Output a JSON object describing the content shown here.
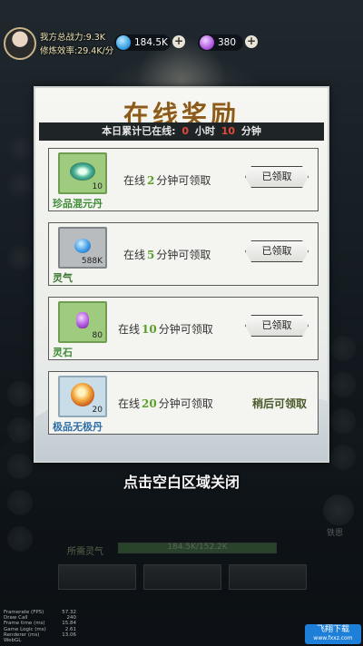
{
  "player": {
    "power_label": "我方总战力:9.3K",
    "efficiency_label": "修炼效率:29.4K/分"
  },
  "resources": [
    {
      "name": "spirit-stone",
      "value": "184.5K",
      "color": "#3aa3e6"
    },
    {
      "name": "jade",
      "value": "380",
      "color": "#b25be0"
    }
  ],
  "modal": {
    "title": "在线奖励",
    "online_prefix": "本日累计已在线:",
    "hours": "0",
    "hour_unit": "小时",
    "minutes": "10",
    "minute_unit": "分钟",
    "rewards": [
      {
        "item_name": "珍品混元丹",
        "count": "10",
        "req_prefix": "在线",
        "req_minutes": "2",
        "req_suffix": "分钟可领取",
        "status": "已领取",
        "claimed": true
      },
      {
        "item_name": "灵气",
        "count": "588K",
        "req_prefix": "在线",
        "req_minutes": "5",
        "req_suffix": "分钟可领取",
        "status": "已领取",
        "claimed": true
      },
      {
        "item_name": "灵石",
        "count": "80",
        "req_prefix": "在线",
        "req_minutes": "10",
        "req_suffix": "分钟可领取",
        "status": "已领取",
        "claimed": true
      },
      {
        "item_name": "极品无极丹",
        "count": "20",
        "req_prefix": "在线",
        "req_minutes": "20",
        "req_suffix": "分钟可领取",
        "status": "稍后可领取",
        "claimed": false
      }
    ]
  },
  "close_hint": "点击空白区域关闭",
  "hud": {
    "required_qi_label": "所需灵气",
    "qi_value": "184.5K/152.2K",
    "qi_fill_fraction": 1.0,
    "logo_label": "铁恩"
  },
  "debug": [
    {
      "k": "Framerate (FPS)",
      "v": "57.32"
    },
    {
      "k": "Draw Call",
      "v": "240"
    },
    {
      "k": "Frame time (ms)",
      "v": "15.84"
    },
    {
      "k": "Game Logic (ms)",
      "v": "2.61"
    },
    {
      "k": "Renderer (ms)",
      "v": "13.06"
    },
    {
      "k": "WebGL",
      "v": ""
    }
  ],
  "watermark": {
    "line1": "飞翔下载",
    "line2": "www.fxxz.com"
  },
  "colors": {
    "accent_red": "#e04a3a",
    "accent_green": "#5a9e2b",
    "title_brown": "#8a5a1f"
  }
}
